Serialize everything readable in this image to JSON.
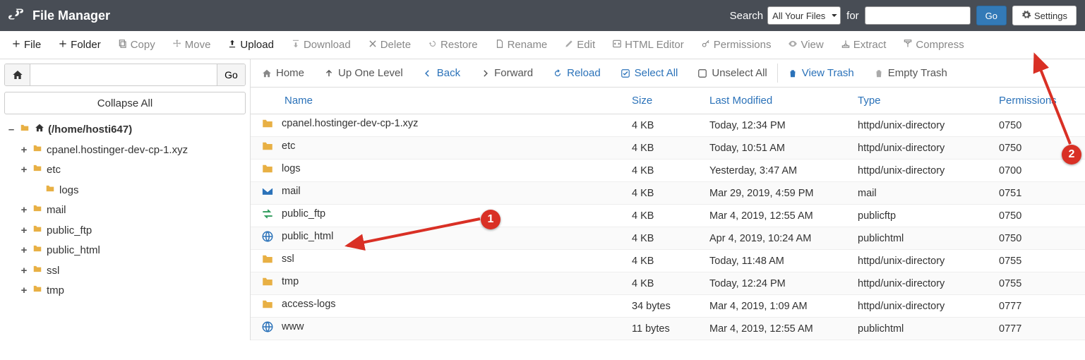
{
  "header": {
    "app_title": "File Manager",
    "search_label": "Search",
    "select_value": "All Your Files",
    "for_label": "for",
    "search_value": "",
    "go": "Go",
    "settings": "Settings"
  },
  "toolbar1": {
    "file": "File",
    "folder": "Folder",
    "copy": "Copy",
    "move": "Move",
    "upload": "Upload",
    "download": "Download",
    "delete": "Delete",
    "restore": "Restore",
    "rename": "Rename",
    "edit": "Edit",
    "html_editor": "HTML Editor",
    "permissions": "Permissions",
    "view": "View",
    "extract": "Extract",
    "compress": "Compress"
  },
  "left": {
    "path_input": "",
    "go": "Go",
    "collapse": "Collapse All",
    "root": "(/home/hosti647)",
    "nodes": {
      "n1": "cpanel.hostinger-dev-cp-1.xyz",
      "n2": "etc",
      "n2a": "logs",
      "n3": "mail",
      "n4": "public_ftp",
      "n5": "public_html",
      "n6": "ssl",
      "n7": "tmp"
    }
  },
  "toolbar2": {
    "home": "Home",
    "up": "Up One Level",
    "back": "Back",
    "forward": "Forward",
    "reload": "Reload",
    "select_all": "Select All",
    "unselect_all": "Unselect All",
    "view_trash": "View Trash",
    "empty_trash": "Empty Trash"
  },
  "columns": {
    "name": "Name",
    "size": "Size",
    "modified": "Last Modified",
    "type": "Type",
    "permissions": "Permissions"
  },
  "rows": [
    {
      "icon": "folder",
      "name": "cpanel.hostinger-dev-cp-1.xyz",
      "size": "4 KB",
      "mod": "Today, 12:34 PM",
      "type": "httpd/unix-directory",
      "perm": "0750"
    },
    {
      "icon": "folder",
      "name": "etc",
      "size": "4 KB",
      "mod": "Today, 10:51 AM",
      "type": "httpd/unix-directory",
      "perm": "0750"
    },
    {
      "icon": "folder",
      "name": "logs",
      "size": "4 KB",
      "mod": "Yesterday, 3:47 AM",
      "type": "httpd/unix-directory",
      "perm": "0700"
    },
    {
      "icon": "mail",
      "name": "mail",
      "size": "4 KB",
      "mod": "Mar 29, 2019, 4:59 PM",
      "type": "mail",
      "perm": "0751"
    },
    {
      "icon": "ftp",
      "name": "public_ftp",
      "size": "4 KB",
      "mod": "Mar 4, 2019, 12:55 AM",
      "type": "publicftp",
      "perm": "0750"
    },
    {
      "icon": "globe",
      "name": "public_html",
      "size": "4 KB",
      "mod": "Apr 4, 2019, 10:24 AM",
      "type": "publichtml",
      "perm": "0750"
    },
    {
      "icon": "folder",
      "name": "ssl",
      "size": "4 KB",
      "mod": "Today, 11:48 AM",
      "type": "httpd/unix-directory",
      "perm": "0755"
    },
    {
      "icon": "folder",
      "name": "tmp",
      "size": "4 KB",
      "mod": "Today, 12:24 PM",
      "type": "httpd/unix-directory",
      "perm": "0755"
    },
    {
      "icon": "folder",
      "name": "access-logs",
      "size": "34 bytes",
      "mod": "Mar 4, 2019, 1:09 AM",
      "type": "httpd/unix-directory",
      "perm": "0777"
    },
    {
      "icon": "globe",
      "name": "www",
      "size": "11 bytes",
      "mod": "Mar 4, 2019, 12:55 AM",
      "type": "publichtml",
      "perm": "0777"
    }
  ],
  "annotations": {
    "one": "1",
    "two": "2"
  }
}
